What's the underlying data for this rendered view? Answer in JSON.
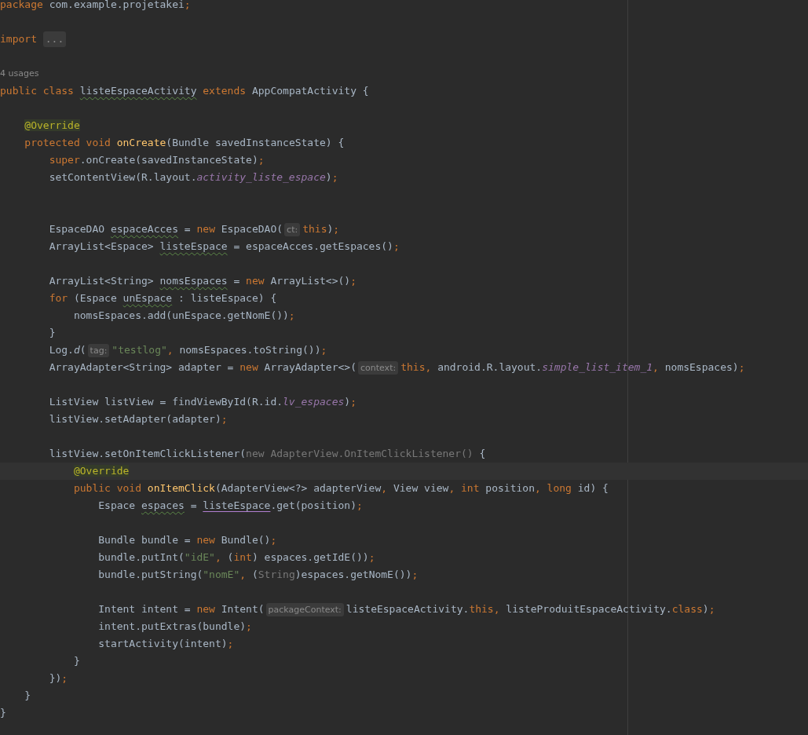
{
  "editor": {
    "lines": [
      {
        "kind": "code",
        "current": false,
        "tokens": [
          {
            "kind": "kw",
            "text": "package "
          },
          {
            "kind": "t",
            "text": "com.example.projetakei"
          },
          {
            "kind": "kw",
            "text": ";"
          }
        ]
      },
      {
        "kind": "blank",
        "current": false
      },
      {
        "kind": "code",
        "current": false,
        "tokens": [
          {
            "kind": "kw",
            "text": "import "
          },
          {
            "kind": "fold",
            "text": "..."
          }
        ]
      },
      {
        "kind": "blank",
        "current": false
      },
      {
        "kind": "usages",
        "current": false,
        "text": "4 usages"
      },
      {
        "kind": "code",
        "current": false,
        "tokens": [
          {
            "kind": "kw",
            "text": "public class "
          },
          {
            "kind": "warn",
            "text": "listeEspaceActivity"
          },
          {
            "kind": "kw",
            "text": " extends "
          },
          {
            "kind": "t",
            "text": "AppCompatActivity {"
          }
        ]
      },
      {
        "kind": "blank",
        "current": false
      },
      {
        "kind": "code",
        "current": false,
        "tokens": [
          {
            "kind": "ann",
            "text": "    @Override"
          }
        ]
      },
      {
        "kind": "code",
        "current": false,
        "tokens": [
          {
            "kind": "kw",
            "text": "    protected void "
          },
          {
            "kind": "fn",
            "text": "onCreate"
          },
          {
            "kind": "t",
            "text": "(Bundle savedInstanceState) {"
          }
        ]
      },
      {
        "kind": "code",
        "current": false,
        "tokens": [
          {
            "kind": "kw",
            "text": "        super"
          },
          {
            "kind": "t",
            "text": ".onCreate(savedInstanceState)"
          },
          {
            "kind": "kw",
            "text": ";"
          }
        ]
      },
      {
        "kind": "code",
        "current": false,
        "tokens": [
          {
            "kind": "t",
            "text": "        setContentView(R.layout."
          },
          {
            "kind": "fld",
            "text": "activity_liste_espace"
          },
          {
            "kind": "t",
            "text": ")"
          },
          {
            "kind": "kw",
            "text": ";"
          }
        ]
      },
      {
        "kind": "blank",
        "current": false
      },
      {
        "kind": "blank",
        "current": false
      },
      {
        "kind": "code",
        "current": false,
        "tokens": [
          {
            "kind": "t",
            "text": "        EspaceDAO "
          },
          {
            "kind": "warn",
            "text": "espaceAcces"
          },
          {
            "kind": "t",
            "text": " = "
          },
          {
            "kind": "kw",
            "text": "new "
          },
          {
            "kind": "t",
            "text": "EspaceDAO("
          },
          {
            "kind": "hint",
            "text": "ct:"
          },
          {
            "kind": "kw",
            "text": "this"
          },
          {
            "kind": "t",
            "text": ")"
          },
          {
            "kind": "kw",
            "text": ";"
          }
        ]
      },
      {
        "kind": "code",
        "current": false,
        "tokens": [
          {
            "kind": "t",
            "text": "        ArrayList<Espace> "
          },
          {
            "kind": "warn",
            "text": "listeEspace"
          },
          {
            "kind": "t",
            "text": " = espaceAcces.getEspaces()"
          },
          {
            "kind": "kw",
            "text": ";"
          }
        ]
      },
      {
        "kind": "blank",
        "current": false
      },
      {
        "kind": "code",
        "current": false,
        "tokens": [
          {
            "kind": "t",
            "text": "        ArrayList<String> "
          },
          {
            "kind": "warn",
            "text": "nomsEspaces"
          },
          {
            "kind": "t",
            "text": " = "
          },
          {
            "kind": "kw",
            "text": "new "
          },
          {
            "kind": "t",
            "text": "ArrayList<>()"
          },
          {
            "kind": "kw",
            "text": ";"
          }
        ]
      },
      {
        "kind": "code",
        "current": false,
        "tokens": [
          {
            "kind": "kw",
            "text": "        for "
          },
          {
            "kind": "t",
            "text": "(Espace "
          },
          {
            "kind": "warn",
            "text": "unEspace"
          },
          {
            "kind": "t",
            "text": " : listeEspace) {"
          }
        ]
      },
      {
        "kind": "code",
        "current": false,
        "tokens": [
          {
            "kind": "t",
            "text": "            nomsEspaces.add(unEspace.getNomE())"
          },
          {
            "kind": "kw",
            "text": ";"
          }
        ]
      },
      {
        "kind": "code",
        "current": false,
        "tokens": [
          {
            "kind": "t",
            "text": "        }"
          }
        ]
      },
      {
        "kind": "code",
        "current": false,
        "tokens": [
          {
            "kind": "t",
            "text": "        Log."
          },
          {
            "kind": "st",
            "text": "d"
          },
          {
            "kind": "t",
            "text": "("
          },
          {
            "kind": "hint",
            "text": "tag:"
          },
          {
            "kind": "str",
            "text": "\"testlog\""
          },
          {
            "kind": "kw",
            "text": ", "
          },
          {
            "kind": "t",
            "text": "nomsEspaces.toString())"
          },
          {
            "kind": "kw",
            "text": ";"
          }
        ]
      },
      {
        "kind": "code",
        "current": false,
        "tokens": [
          {
            "kind": "t",
            "text": "        ArrayAdapter<String> adapter = "
          },
          {
            "kind": "kw",
            "text": "new "
          },
          {
            "kind": "t",
            "text": "ArrayAdapter<>("
          },
          {
            "kind": "hint",
            "text": "context:"
          },
          {
            "kind": "kw",
            "text": "this, "
          },
          {
            "kind": "t",
            "text": "android.R.layout."
          },
          {
            "kind": "fld",
            "text": "simple_list_item_1"
          },
          {
            "kind": "kw",
            "text": ", "
          },
          {
            "kind": "t",
            "text": "nomsEspaces)"
          },
          {
            "kind": "kw",
            "text": ";"
          }
        ]
      },
      {
        "kind": "blank",
        "current": false
      },
      {
        "kind": "code",
        "current": false,
        "tokens": [
          {
            "kind": "t",
            "text": "        ListView listView = findViewById(R.id."
          },
          {
            "kind": "fld",
            "text": "lv_espaces"
          },
          {
            "kind": "t",
            "text": ")"
          },
          {
            "kind": "kw",
            "text": ";"
          }
        ]
      },
      {
        "kind": "code",
        "current": false,
        "tokens": [
          {
            "kind": "t",
            "text": "        listView.setAdapter(adapter)"
          },
          {
            "kind": "kw",
            "text": ";"
          }
        ]
      },
      {
        "kind": "blank",
        "current": false
      },
      {
        "kind": "code",
        "current": false,
        "tokens": [
          {
            "kind": "t",
            "text": "        listView.setOnItemClickListener("
          },
          {
            "kind": "dim",
            "text": "new AdapterView.OnItemClickListener()"
          },
          {
            "kind": "t",
            "text": " {"
          }
        ]
      },
      {
        "kind": "code",
        "current": true,
        "tokens": [
          {
            "kind": "ann",
            "text": "            @Override"
          }
        ]
      },
      {
        "kind": "code",
        "current": false,
        "tokens": [
          {
            "kind": "kw",
            "text": "            public void "
          },
          {
            "kind": "fn",
            "text": "onItemClick"
          },
          {
            "kind": "t",
            "text": "(AdapterView<?> adapterView"
          },
          {
            "kind": "kw",
            "text": ", "
          },
          {
            "kind": "t",
            "text": "View view"
          },
          {
            "kind": "kw",
            "text": ", int "
          },
          {
            "kind": "t",
            "text": "position"
          },
          {
            "kind": "kw",
            "text": ", long "
          },
          {
            "kind": "t",
            "text": "id) {"
          }
        ]
      },
      {
        "kind": "code",
        "current": false,
        "tokens": [
          {
            "kind": "t",
            "text": "                Espace "
          },
          {
            "kind": "warn",
            "text": "espaces"
          },
          {
            "kind": "t",
            "text": " = "
          },
          {
            "kind": "ref",
            "text": "listeEspace"
          },
          {
            "kind": "t",
            "text": ".get(position)"
          },
          {
            "kind": "kw",
            "text": ";"
          }
        ]
      },
      {
        "kind": "blank",
        "current": false
      },
      {
        "kind": "code",
        "current": false,
        "tokens": [
          {
            "kind": "t",
            "text": "                Bundle bundle = "
          },
          {
            "kind": "kw",
            "text": "new "
          },
          {
            "kind": "t",
            "text": "Bundle()"
          },
          {
            "kind": "kw",
            "text": ";"
          }
        ]
      },
      {
        "kind": "code",
        "current": false,
        "tokens": [
          {
            "kind": "t",
            "text": "                bundle.putInt("
          },
          {
            "kind": "str",
            "text": "\"idE\""
          },
          {
            "kind": "kw",
            "text": ", "
          },
          {
            "kind": "t",
            "text": "("
          },
          {
            "kind": "kw",
            "text": "int"
          },
          {
            "kind": "t",
            "text": ") espaces.getIdE())"
          },
          {
            "kind": "kw",
            "text": ";"
          }
        ]
      },
      {
        "kind": "code",
        "current": false,
        "tokens": [
          {
            "kind": "t",
            "text": "                bundle.putString("
          },
          {
            "kind": "str",
            "text": "\"nomE\""
          },
          {
            "kind": "kw",
            "text": ", "
          },
          {
            "kind": "t",
            "text": "("
          },
          {
            "kind": "dim",
            "text": "String"
          },
          {
            "kind": "t",
            "text": ")espaces.getNomE())"
          },
          {
            "kind": "kw",
            "text": ";"
          }
        ]
      },
      {
        "kind": "blank",
        "current": false
      },
      {
        "kind": "code",
        "current": false,
        "tokens": [
          {
            "kind": "t",
            "text": "                Intent intent = "
          },
          {
            "kind": "kw",
            "text": "new "
          },
          {
            "kind": "t",
            "text": "Intent("
          },
          {
            "kind": "hint",
            "text": "packageContext:"
          },
          {
            "kind": "t",
            "text": "listeEspaceActivity."
          },
          {
            "kind": "kw",
            "text": "this, "
          },
          {
            "kind": "t",
            "text": "listeProduitEspaceActivity."
          },
          {
            "kind": "kw",
            "text": "class"
          },
          {
            "kind": "t",
            "text": ")"
          },
          {
            "kind": "kw",
            "text": ";"
          }
        ]
      },
      {
        "kind": "code",
        "current": false,
        "tokens": [
          {
            "kind": "t",
            "text": "                intent.putExtras(bundle)"
          },
          {
            "kind": "kw",
            "text": ";"
          }
        ]
      },
      {
        "kind": "code",
        "current": false,
        "tokens": [
          {
            "kind": "t",
            "text": "                startActivity(intent)"
          },
          {
            "kind": "kw",
            "text": ";"
          }
        ]
      },
      {
        "kind": "code",
        "current": false,
        "tokens": [
          {
            "kind": "t",
            "text": "            }"
          }
        ]
      },
      {
        "kind": "code",
        "current": false,
        "tokens": [
          {
            "kind": "t",
            "text": "        })"
          },
          {
            "kind": "kw",
            "text": ";"
          }
        ]
      },
      {
        "kind": "code",
        "current": false,
        "tokens": [
          {
            "kind": "t",
            "text": "    }"
          }
        ]
      },
      {
        "kind": "code",
        "current": false,
        "tokens": [
          {
            "kind": "t",
            "text": "}"
          }
        ]
      }
    ]
  }
}
